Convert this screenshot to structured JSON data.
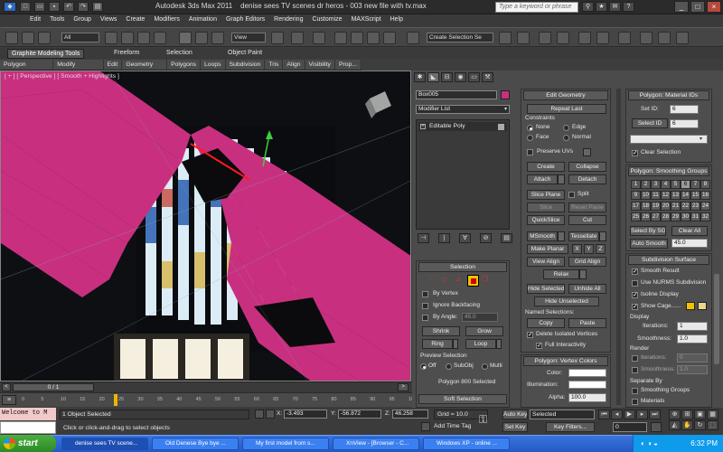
{
  "title": {
    "app": "Autodesk 3ds Max  2011",
    "document": "denise sees TV scenes dr heros - 003  new file with tv.max",
    "search_placeholder": "Type a keyword or phrase"
  },
  "menu": [
    "Edit",
    "Tools",
    "Group",
    "Views",
    "Create",
    "Modifiers",
    "Animation",
    "Graph Editors",
    "Rendering",
    "Customize",
    "MAXScript",
    "Help"
  ],
  "toolbar": {
    "selection_filter": "All",
    "ref_coord": "View",
    "named_selection": "Create Selection Se"
  },
  "ribbon": {
    "tabs": [
      "Graphite Modeling Tools",
      "Freeform",
      "Selection",
      "Object Paint"
    ],
    "sub": [
      "Polygon Modeling",
      "Modify Selection",
      "Edit",
      "Geometry (All)",
      "Polygons",
      "Loops",
      "Subdivision",
      "Tris",
      "Align",
      "Visibility",
      "Prop..."
    ]
  },
  "viewport": {
    "label": "[ + ] [ Perspective ] [ Smooth + Highlights ]"
  },
  "timeline": {
    "frame": "0 / 1",
    "ticks": [
      "0",
      "5",
      "10",
      "15",
      "20",
      "25",
      "30",
      "35",
      "40",
      "45",
      "50",
      "55",
      "60",
      "65",
      "70",
      "75",
      "80",
      "85",
      "90",
      "95",
      "100"
    ]
  },
  "status": {
    "listener_text": "Welcome to M",
    "objects_selected": "1 Object Selected",
    "prompt": "Click or click-and-drag to select objects",
    "x_label": "X:",
    "x": "-3.493",
    "y_label": "Y:",
    "y": "-56.872",
    "z_label": "Z:",
    "z": "46.258",
    "grid": "Grid = 10.0",
    "add_time_tag": "Add Time Tag",
    "auto_key": "Auto Key",
    "set_key": "Set Key",
    "selected": "Selected",
    "key_filters": "Key Filters...",
    "frame_num": "0"
  },
  "modify": {
    "object_name": "Box005",
    "modifier_list": "Modifier List",
    "stack_item": "Editable Poly"
  },
  "selection": {
    "header": "Selection",
    "by_vertex": "By Vertex",
    "ignore_backfacing": "Ignore Backfacing",
    "by_angle": "By Angle:",
    "angle": "45.0",
    "shrink": "Shrink",
    "grow": "Grow",
    "ring": "Ring",
    "loop": "Loop",
    "preview_header": "Preview Selection",
    "off": "Off",
    "subobj": "SubObj",
    "multi": "Multi",
    "status": "Polygon 800 Selected",
    "soft_header": "Soft Selection"
  },
  "edit_geometry": {
    "header": "Edit Geometry",
    "repeat_last": "Repeat Last",
    "constraints": "Constraints",
    "none": "None",
    "edge": "Edge",
    "face": "Face",
    "normal": "Normal",
    "preserve_uvs": "Preserve UVs",
    "create": "Create",
    "collapse": "Collapse",
    "attach": "Attach",
    "detach": "Detach",
    "slice_plane": "Slice Plane",
    "split": "Split",
    "slice": "Slice",
    "reset_plane": "Reset Plane",
    "quickslice": "QuickSlice",
    "cut": "Cut",
    "msmooth": "MSmooth",
    "tessellate": "Tessellate",
    "make_planar": "Make Planar",
    "x": "X",
    "y": "Y",
    "z": "Z",
    "view_align": "View Align",
    "grid_align": "Grid Align",
    "relax": "Relax",
    "hide_selected": "Hide Selected",
    "unhide_all": "Unhide All",
    "hide_unselected": "Hide Unselected",
    "named_selections": "Named Selections:",
    "copy": "Copy",
    "paste": "Paste",
    "delete_isolated": "Delete Isolated Vertices",
    "full_interactivity": "Full Interactivity"
  },
  "vertex_colors": {
    "header": "Polygon: Vertex Colors",
    "color": "Color:",
    "illumination": "Illumination:",
    "alpha": "Alpha:",
    "alpha_value": "100.0"
  },
  "material_ids": {
    "header": "Polygon: Material IDs",
    "set_id": "Set ID:",
    "set_id_value": "6",
    "select_id": "Select ID",
    "select_id_value": "6",
    "clear_selection": "Clear Selection"
  },
  "smoothing": {
    "header": "Polygon: Smoothing Groups",
    "groups": [
      "1",
      "2",
      "3",
      "4",
      "5",
      "6",
      "7",
      "8",
      "9",
      "10",
      "11",
      "12",
      "13",
      "14",
      "15",
      "16",
      "17",
      "18",
      "19",
      "20",
      "21",
      "22",
      "23",
      "24",
      "25",
      "26",
      "27",
      "28",
      "29",
      "30",
      "31",
      "32"
    ],
    "select_by_sg": "Select By SG",
    "clear_all": "Clear All",
    "auto_smooth": "Auto Smooth",
    "auto_smooth_value": "45.0"
  },
  "subdivision": {
    "header": "Subdivision Surface",
    "smooth_result": "Smooth Result",
    "use_nurms": "Use NURMS Subdivision",
    "isoline": "Isoline Display",
    "show_cage": "Show Cage......",
    "display": "Display",
    "iterations": "Iterations:",
    "iterations_value": "1",
    "smoothness": "Smoothness:",
    "smoothness_value": "1.0",
    "render": "Render",
    "r_iterations": "Iterations:",
    "r_iterations_value": "0",
    "r_smoothness": "Smoothness:",
    "r_smoothness_value": "1.0",
    "separate_by": "Separate By",
    "smoothing_groups": "Smoothing Groups",
    "materials": "Materials"
  },
  "taskbar": {
    "start": "start",
    "tasks": [
      "denise sees TV scene...",
      "Old Denese Bye bye ...",
      "My first model from s...",
      "XnView - [Browser - C...",
      "Windows XP - online ..."
    ],
    "time": "6:32 PM"
  },
  "colors": {
    "magenta": "#c8307f",
    "accent": "#f2c200"
  }
}
